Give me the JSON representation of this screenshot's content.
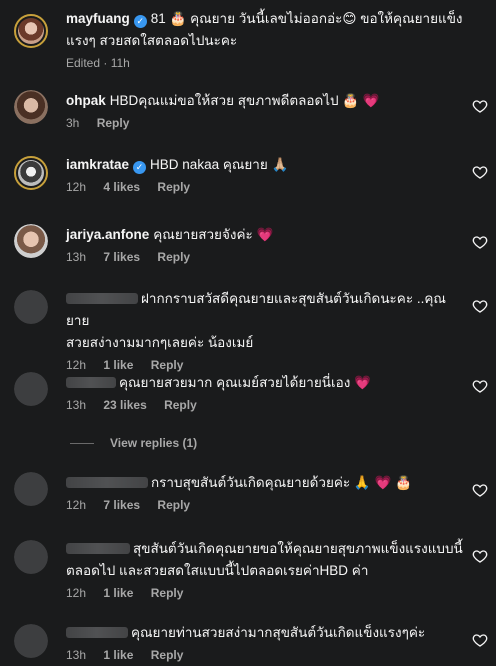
{
  "comments": [
    {
      "username": "mayfuang",
      "verified": true,
      "text_line1": "81 🎂 คุณยาย วันนี้เลขไม่ออกอ่ะ😊 ขอให้คุณยายแข็ง",
      "text_line2": "แรงๆ สวยสดใสตลอดไปนะคะ",
      "time": "Edited · 11h"
    },
    {
      "username": "ohpak",
      "verified": false,
      "text": "HBDคุณแม่ขอให้สวย สุขภาพดีตลอดไป 🎂 💗",
      "time": "3h",
      "reply": "Reply"
    },
    {
      "username": "iamkratae",
      "verified": true,
      "text": "HBD nakaa คุณยาย 🙏🏼",
      "time": "12h",
      "likes": "4 likes",
      "reply": "Reply"
    },
    {
      "username": "jariya.anfone",
      "verified": false,
      "text": "คุณยายสวยจังค่ะ 💗",
      "time": "13h",
      "likes": "7 likes",
      "reply": "Reply"
    },
    {
      "text_line1": "ฝากกราบสวัสดีคุณยายและสุขสันต์วันเกิดนะคะ ..คุณยาย",
      "text_line2": "สวยสง่างามมากๆเลยค่ะ น้องเมย์",
      "time": "12h",
      "likes": "1 like",
      "reply": "Reply"
    },
    {
      "text": "คุณยายสวยมาก คุณเมย์สวยได้ยายนี่เอง 💗",
      "time": "13h",
      "likes": "23 likes",
      "reply": "Reply"
    },
    {
      "text": "กราบสุขสันต์วันเกิดคุณยายด้วยค่ะ 🙏 💗 🎂",
      "time": "12h",
      "likes": "7 likes",
      "reply": "Reply"
    },
    {
      "text_line1": "สุขสันต์วันเกิดคุณยายขอให้คุณยายสุขภาพแข็งแรงแบบนี้",
      "text_line2": "ตลอดไป และสวยสดใสแบบนี้ไปตลอดเรยค่าHBD ค่า",
      "time": "12h",
      "likes": "1 like",
      "reply": "Reply"
    },
    {
      "text": "คุณยายท่านสวยสง่ามากสุขสันต์วันเกิดแข็งแรงๆค่ะ",
      "time": "13h",
      "likes": "1 like",
      "reply": "Reply"
    }
  ],
  "view_replies": "View replies (1)",
  "colors": {
    "background": "#1a1b1c",
    "text": "#f5f5f5",
    "muted": "#a8a8a8",
    "verified": "#3897f0",
    "story_ring": "#c7a03b"
  }
}
